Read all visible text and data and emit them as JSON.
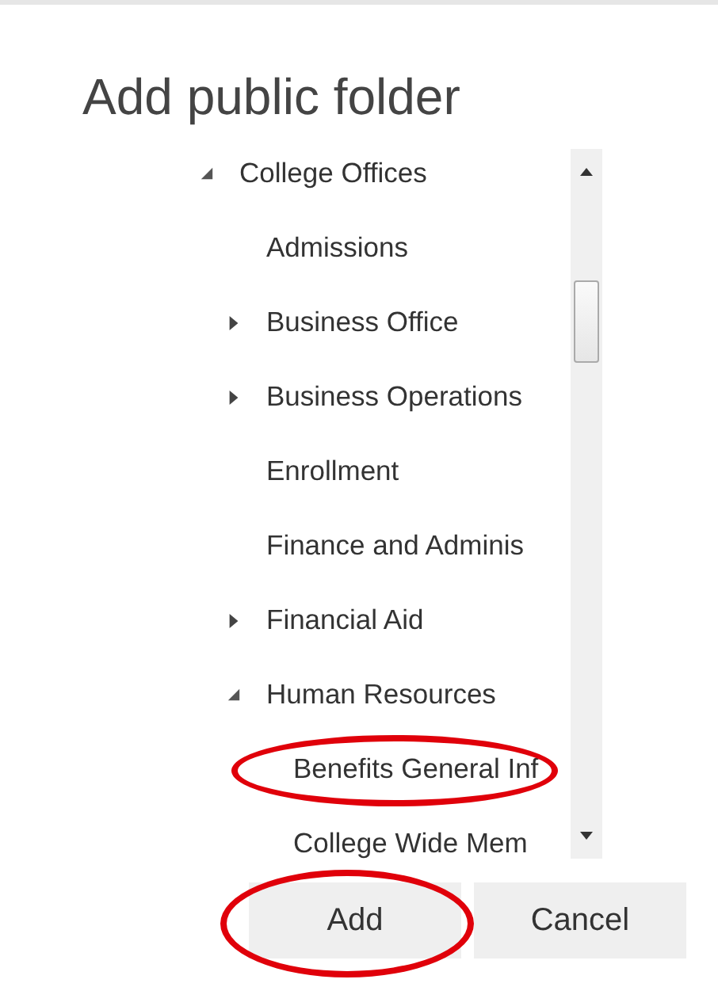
{
  "dialog": {
    "title": "Add public folder"
  },
  "tree": [
    {
      "label": "College Offices",
      "expanded": true,
      "circled": false,
      "children": [
        {
          "label": "Admissions",
          "circled": false
        },
        {
          "label": "Business Office",
          "expanded": false,
          "circled": false
        },
        {
          "label": "Business Operations",
          "expanded": false,
          "circled": false
        },
        {
          "label": "Enrollment",
          "circled": false
        },
        {
          "label": "Finance and Adminis",
          "circled": false
        },
        {
          "label": "Financial Aid",
          "expanded": false,
          "circled": false
        },
        {
          "label": "Human Resources",
          "expanded": true,
          "circled": false,
          "children": [
            {
              "label": "Benefits General Inf",
              "circled": true
            },
            {
              "label": "College Wide Mem",
              "circled": false
            }
          ]
        }
      ]
    }
  ],
  "buttons": [
    {
      "label": "Add",
      "circled": true
    },
    {
      "label": "Cancel",
      "circled": false
    }
  ]
}
